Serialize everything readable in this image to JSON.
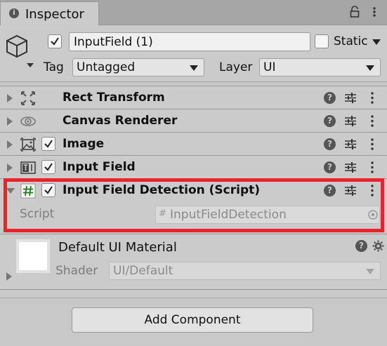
{
  "tab": {
    "title": "Inspector",
    "info_glyph": "i"
  },
  "header": {
    "object_name": "InputField (1)",
    "active": true,
    "static_label": "Static",
    "static_checked": false,
    "tag_label": "Tag",
    "tag_value": "Untagged",
    "layer_label": "Layer",
    "layer_value": "UI"
  },
  "components": [
    {
      "title": "Rect Transform",
      "icon": "rect-transform-icon",
      "has_checkbox": false,
      "expanded": false
    },
    {
      "title": "Canvas Renderer",
      "icon": "canvas-renderer-icon",
      "has_checkbox": false,
      "expanded": false
    },
    {
      "title": "Image",
      "icon": "image-icon",
      "has_checkbox": true,
      "checked": true,
      "expanded": false
    },
    {
      "title": "Input Field",
      "icon": "input-field-icon",
      "has_checkbox": true,
      "checked": true,
      "expanded": false
    },
    {
      "title": "Input Field Detection (Script)",
      "icon": "script-icon",
      "has_checkbox": true,
      "checked": true,
      "expanded": true
    }
  ],
  "script_field": {
    "label": "Script",
    "value": "InputFieldDetection",
    "hash_glyph": "#"
  },
  "material": {
    "name": "Default UI Material",
    "shader_label": "Shader",
    "shader_value": "UI/Default"
  },
  "add_component_label": "Add Component",
  "icons": {
    "help_glyph": "?"
  },
  "colors": {
    "highlight": "#e8232c",
    "panel": "#cbcbcb",
    "script_icon": "#1f7a1f"
  }
}
